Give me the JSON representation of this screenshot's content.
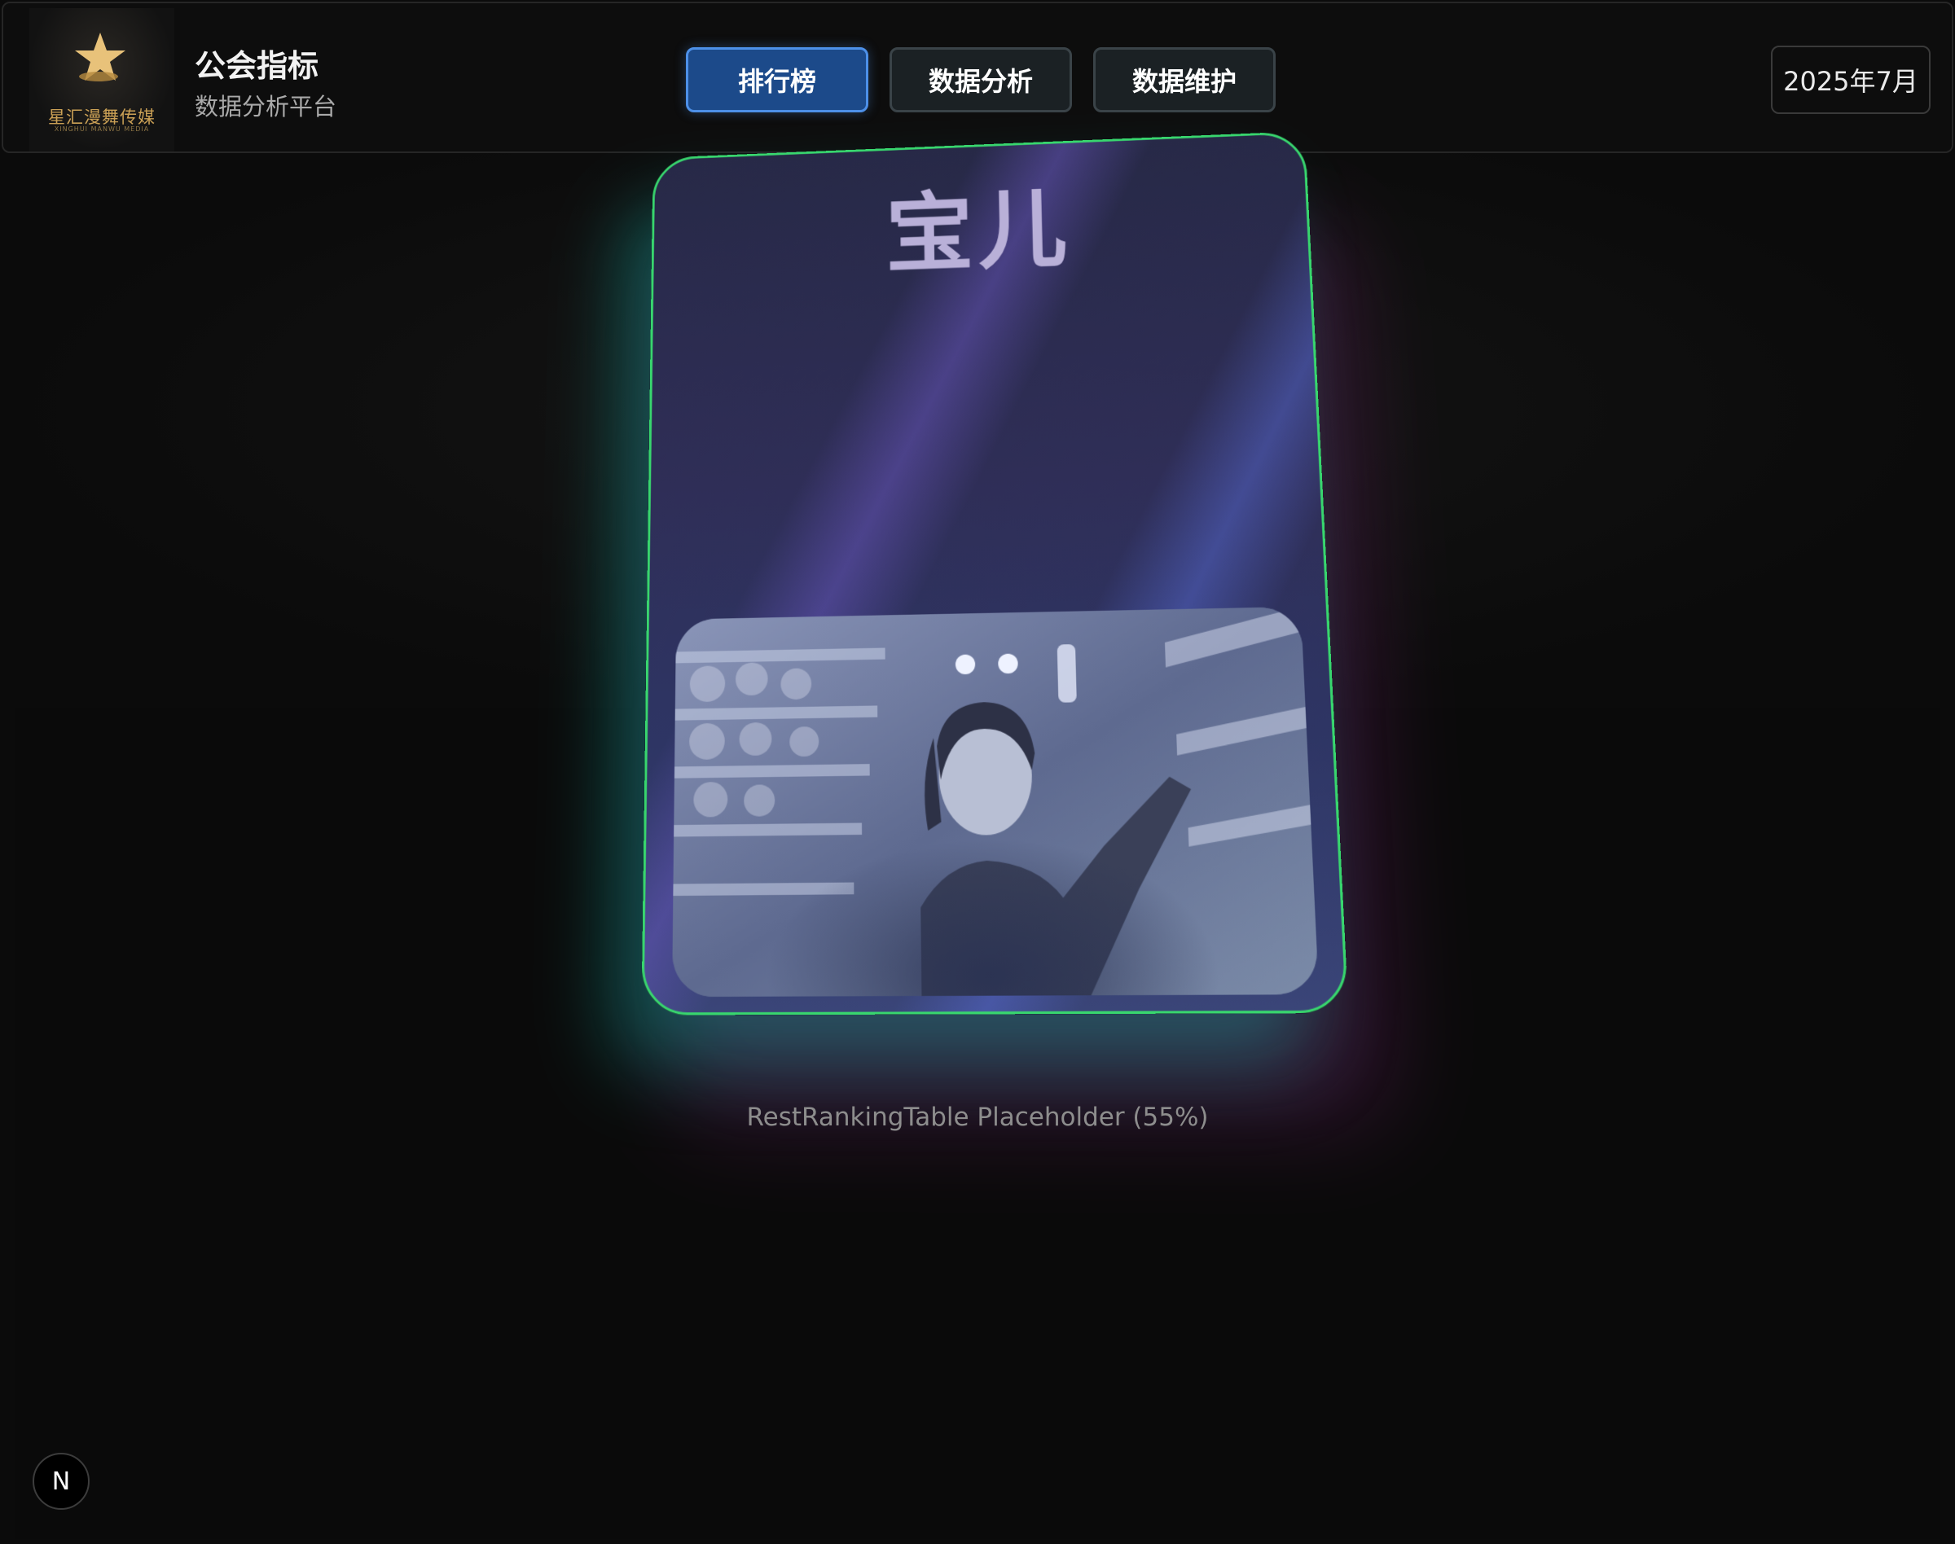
{
  "header": {
    "logo": {
      "name": "星汇漫舞传媒",
      "subtext": "XINGHUI MANWU MEDIA"
    },
    "title": "公会指标",
    "subtitle": "数据分析平台",
    "nav": [
      {
        "label": "排行榜",
        "active": true
      },
      {
        "label": "数据分析",
        "active": false
      },
      {
        "label": "数据维护",
        "active": false
      }
    ],
    "date": "2025年7月"
  },
  "card": {
    "name": "宝儿",
    "border_color": "#38d66e"
  },
  "placeholder_text": "RestRankingTable Placeholder (55%)",
  "badge": {
    "letter": "N"
  },
  "colors": {
    "background": "#0b0b0b",
    "nav_active": "#1c4a8a",
    "nav_active_border": "#4d90e8",
    "card_top": "#272947",
    "card_bottom": "#3a4578",
    "logo_gold": "#caa055"
  },
  "icons": {
    "logo": "star-logo-icon",
    "badge": "n-letter-icon"
  }
}
